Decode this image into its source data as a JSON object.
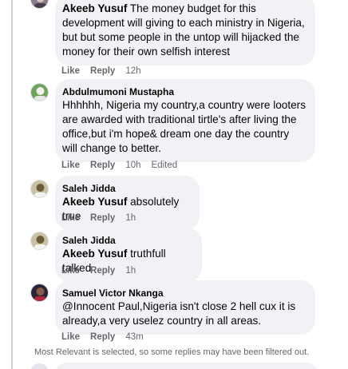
{
  "comments": [
    {
      "author": "",
      "mention": "Akeeb Yusuf",
      "text": "The money budget for this development will giving to each ministry in Nigeria, but but some people in the untop will hijacked the money for their own selfish interest",
      "like": "Like",
      "reply": "Reply",
      "time": "12h",
      "edited": ""
    },
    {
      "author": "Abdulmumoni Mustapha",
      "mention": "",
      "text": "Hhhhhh, Nigeria my country,a country were looters are awarded with traditional tirtle's after living the office,but i'm hope& dream one day the country will change to better.",
      "like": "Like",
      "reply": "Reply",
      "time": "10h",
      "edited": "Edited"
    },
    {
      "author": "Saleh Jidda",
      "mention": "Akeeb Yusuf",
      "text": "absolutely true",
      "like": "Like",
      "reply": "Reply",
      "time": "1h",
      "edited": ""
    },
    {
      "author": "Saleh Jidda",
      "mention": "Akeeb Yusuf",
      "text": "truthfull talked",
      "like": "Like",
      "reply": "Reply",
      "time": "1h",
      "edited": ""
    },
    {
      "author": "Samuel Victor Nkanga",
      "mention": "",
      "text": "@Innocent Paul,Nigeria isn't close 2 hell cux it is already,a very uselez country in all areas.",
      "like": "Like",
      "reply": "Reply",
      "time": "43m",
      "edited": ""
    }
  ],
  "footer": {
    "filter_note": "Most Relevant is selected, so some replies may have been filtered out."
  },
  "colors": {
    "bubble": "#f0f2f5",
    "secondary_text": "#65676b",
    "primary_text": "#050505"
  }
}
